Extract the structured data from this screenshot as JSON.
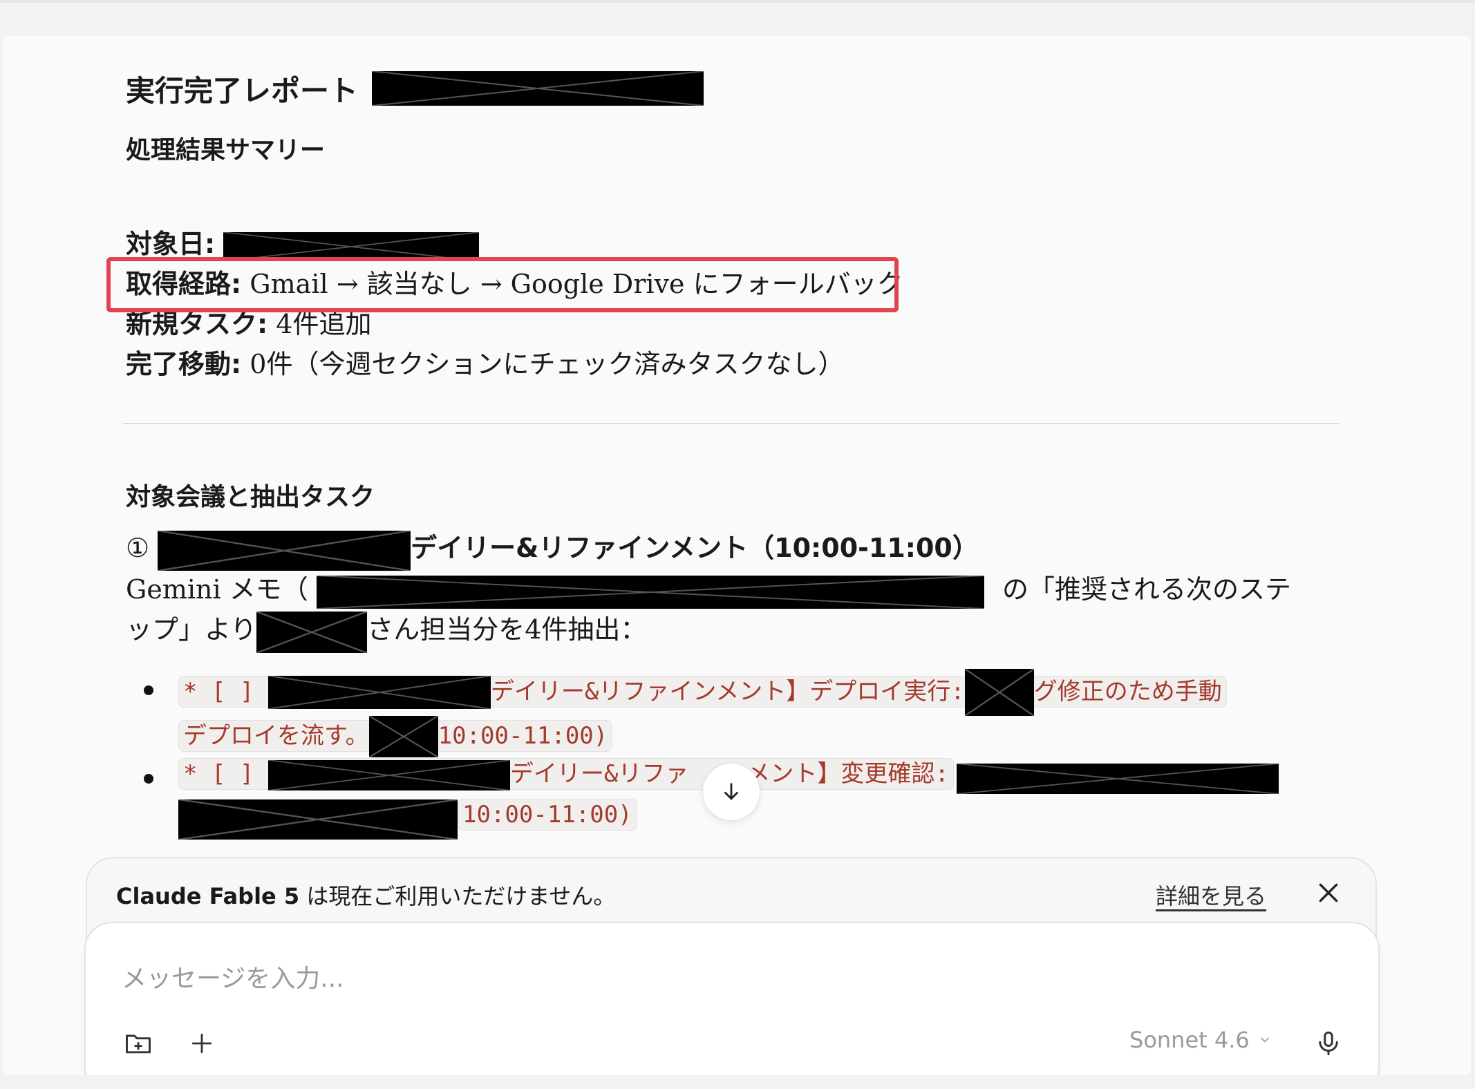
{
  "report": {
    "title": "実行完了レポート",
    "summary_heading": "処理結果サマリー",
    "target_date_label": "対象日:",
    "route_label": "取得経路:",
    "route_value": "Gmail → 該当なし → Google Drive にフォールバック",
    "new_tasks_label": "新規タスク:",
    "new_tasks_value": "4件追加",
    "moved_label": "完了移動:",
    "moved_value": "0件（今週セクションにチェック済みタスクなし）"
  },
  "meetings": {
    "heading": "対象会議と抽出タスク",
    "meeting1": {
      "number": "①",
      "title_tail": "デイリー&リファインメント（10:00-11:00）",
      "desc_start": "Gemini メモ（",
      "desc_mid": "の「推奨される次のステ",
      "desc_line2_a": "ップ」より",
      "desc_line2_b": "さん担当分を4件抽出："
    },
    "tasks": [
      {
        "prefix": "* [ ]",
        "part1": "デイリー&リファインメント】デプロイ実行:",
        "part2": "グ修正のため手動",
        "part3": "デプロイを流す。",
        "part4": "10:00-11:00)"
      },
      {
        "prefix": "* [ ]",
        "part1": "デイリー&リファ",
        "part2": "メント】変更確認:",
        "part3": "10:00-11:00)"
      }
    ]
  },
  "notice": {
    "text_bold": "Claude Fable 5",
    "text_rest": " は現在ご利用いただけません。",
    "link": "詳細を見る"
  },
  "composer": {
    "placeholder": "メッセージを入力...",
    "model": "Sonnet 4.6"
  },
  "icons": {
    "scroll_down": "arrow-down-icon",
    "close": "close-icon",
    "folder": "folder-plus-icon",
    "plus": "plus-icon",
    "mic": "microphone-icon",
    "chevron": "chevron-down-icon"
  },
  "colors": {
    "highlight": "#e0454f",
    "code_text": "#a43a2b"
  }
}
